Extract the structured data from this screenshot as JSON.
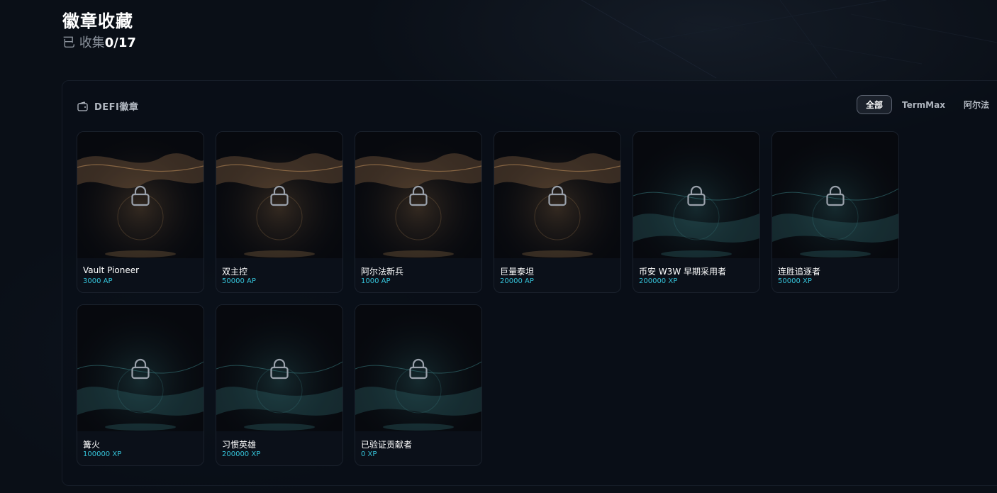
{
  "header": {
    "title": "徽章收藏",
    "collected_label": "已 收集",
    "collected_count": "0/17"
  },
  "section": {
    "title": "DEFI徽章",
    "icon": "wallet-icon",
    "filters": [
      {
        "label": "全部",
        "active": true
      },
      {
        "label": "TermMax",
        "active": false
      },
      {
        "label": "阿尔法",
        "active": false
      }
    ]
  },
  "badges": [
    {
      "name": "Vault Pioneer",
      "points": "3000 AP",
      "theme": "gold",
      "icon": "lock-icon"
    },
    {
      "name": "双主控",
      "points": "50000 AP",
      "theme": "gold",
      "icon": "lock-icon"
    },
    {
      "name": "阿尔法新兵",
      "points": "1000 AP",
      "theme": "gold",
      "icon": "lock-icon"
    },
    {
      "name": "巨量泰坦",
      "points": "20000 AP",
      "theme": "gold",
      "icon": "lock-icon"
    },
    {
      "name": "币安 W3W 早期采用者",
      "points": "200000 XP",
      "theme": "teal",
      "icon": "lock-icon"
    },
    {
      "name": "连胜追逐者",
      "points": "50000 XP",
      "theme": "teal",
      "icon": "lock-icon"
    },
    {
      "name": "篝火",
      "points": "100000 XP",
      "theme": "teal",
      "icon": "lock-icon"
    },
    {
      "name": "习惯英雄",
      "points": "200000 XP",
      "theme": "teal",
      "icon": "lock-icon"
    },
    {
      "name": "已验证贡献者",
      "points": "0 XP",
      "theme": "teal",
      "icon": "lock-icon"
    }
  ],
  "colors": {
    "background": "#0a0f17",
    "accent_points": "#35c2d8",
    "gold_glow": "#b98a58",
    "teal_glow": "#3f8c8f"
  }
}
